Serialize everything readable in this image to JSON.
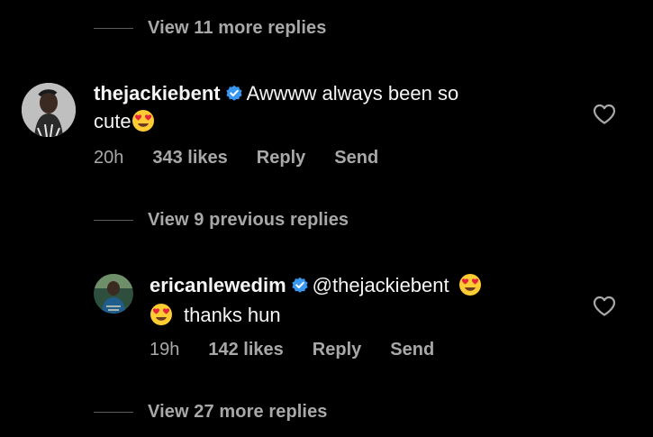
{
  "thread": {
    "view_more_1": "View 11 more replies",
    "view_previous": "View 9 previous replies",
    "view_more_2": "View 27 more replies"
  },
  "comment1": {
    "username": "thejackiebent",
    "text_line1": "Awwww always been so",
    "text_line2": "cute",
    "time": "20h",
    "likes": "343 likes",
    "reply_label": "Reply",
    "send_label": "Send"
  },
  "comment2": {
    "username": "ericanlewedim",
    "mention": "@thejackiebent",
    "text_line2": "thanks hun",
    "time": "19h",
    "likes": "142 likes",
    "reply_label": "Reply",
    "send_label": "Send"
  },
  "colors": {
    "background": "#000000",
    "text": "#f5f5f5",
    "secondary_text": "#a8a8a8",
    "verified_badge": "#3897f0"
  },
  "icons": [
    "verified-badge-icon",
    "heart-eyes-emoji",
    "heart-outline-icon"
  ]
}
